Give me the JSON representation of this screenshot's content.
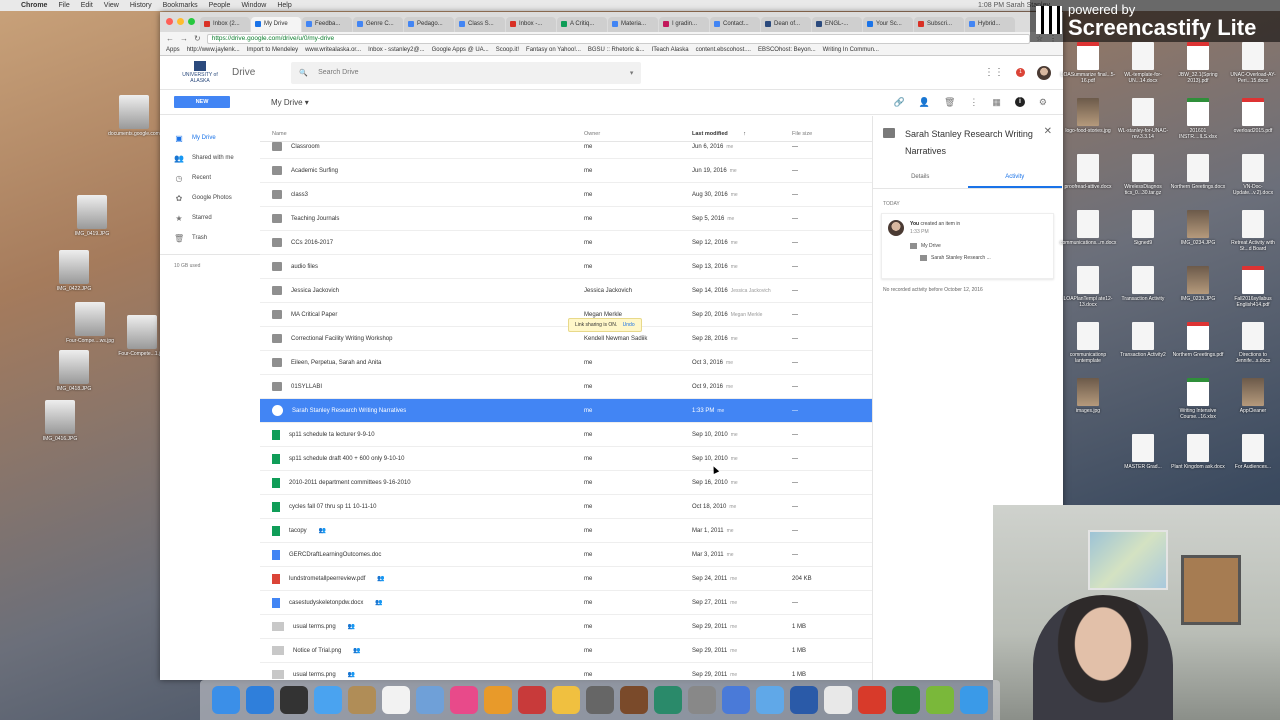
{
  "menubar": {
    "app": "Chrome",
    "items": [
      "File",
      "Edit",
      "View",
      "History",
      "Bookmarks",
      "People",
      "Window",
      "Help"
    ],
    "right_text": "1:08 PM   Sarah Stanley"
  },
  "browser": {
    "tabs": [
      {
        "label": "Inbox (2...",
        "color": "#d93025"
      },
      {
        "label": "My Drive",
        "color": "#1a73e8",
        "active": true
      },
      {
        "label": "Feedba...",
        "color": "#4285f4"
      },
      {
        "label": "Genre C...",
        "color": "#4285f4"
      },
      {
        "label": "Pedago...",
        "color": "#4285f4"
      },
      {
        "label": "Class S...",
        "color": "#4285f4"
      },
      {
        "label": "Inbox -...",
        "color": "#d93025"
      },
      {
        "label": "A Critiq...",
        "color": "#0f9d58"
      },
      {
        "label": "Materia...",
        "color": "#4285f4"
      },
      {
        "label": "I gradin...",
        "color": "#c2185b"
      },
      {
        "label": "Contact...",
        "color": "#4285f4"
      },
      {
        "label": "Dean of...",
        "color": "#2b4a7d"
      },
      {
        "label": "ENGL-...",
        "color": "#2b4a7d"
      },
      {
        "label": "Your Sc...",
        "color": "#1a73e8"
      },
      {
        "label": "Subscri...",
        "color": "#d93025"
      },
      {
        "label": "Hybrid...",
        "color": "#4285f4"
      }
    ],
    "url": "https://drive.google.com/drive/u/0/my-drive",
    "bookmarks": [
      "Apps",
      "http://www.jaylenk...",
      "Import to Mendeley",
      "www.writealaska.or...",
      "Inbox - sstanley2@...",
      "Google Apps @ UA...",
      "Scoop.it!",
      "Fantasy on Yahoo!...",
      "BGSU :: Rhetoric &...",
      "ITeach Alaska",
      "content.ebscohost....",
      "EBSCOhost: Beyon...",
      "Writing In Commun..."
    ]
  },
  "drive": {
    "logo_text": "UNIVERSITY of ALASKA",
    "product": "Drive",
    "search_placeholder": "Search Drive",
    "notif_count": "1",
    "new_button": "NEW",
    "location_label": "My Drive",
    "sidebar": [
      {
        "label": "My Drive",
        "icon": "drive-icon",
        "glyph": "▣",
        "active": true
      },
      {
        "label": "Shared with me",
        "icon": "people-icon",
        "glyph": "👥"
      },
      {
        "label": "Recent",
        "icon": "clock-icon",
        "glyph": "◷"
      },
      {
        "label": "Google Photos",
        "icon": "photos-icon",
        "glyph": "✿"
      },
      {
        "label": "Starred",
        "icon": "star-icon",
        "glyph": "★"
      },
      {
        "label": "Trash",
        "icon": "trash-icon",
        "glyph": "🗑"
      }
    ],
    "storage": "10 GB used",
    "columns": {
      "name": "Name",
      "owner": "Owner",
      "modified": "Last modified",
      "size": "File size"
    },
    "files": [
      {
        "name": "Classroom",
        "type": "shared-folder",
        "owner": "me",
        "modified": "Jun 6, 2016",
        "by": "me",
        "size": "—"
      },
      {
        "name": "Academic Surfing",
        "type": "folder",
        "owner": "me",
        "modified": "Jun 19, 2016",
        "by": "me",
        "size": "—"
      },
      {
        "name": "class3",
        "type": "folder",
        "owner": "me",
        "modified": "Aug 30, 2016",
        "by": "me",
        "size": "—"
      },
      {
        "name": "Teaching Journals",
        "type": "folder",
        "owner": "me",
        "modified": "Sep 5, 2016",
        "by": "me",
        "size": "—"
      },
      {
        "name": "CCs 2016-2017",
        "type": "shared-folder",
        "owner": "me",
        "modified": "Sep 12, 2016",
        "by": "me",
        "size": "—"
      },
      {
        "name": "audio files",
        "type": "shared-folder",
        "owner": "me",
        "modified": "Sep 13, 2016",
        "by": "me",
        "size": "—"
      },
      {
        "name": "Jessica Jackovich",
        "type": "shared-folder",
        "owner": "Jessica Jackovich",
        "modified": "Sep 14, 2016",
        "by": "Jessica Jackovich",
        "size": "—"
      },
      {
        "name": "MA Critical Paper",
        "type": "shared-folder",
        "owner": "Megan Merkle",
        "modified": "Sep 20, 2016",
        "by": "Megan Merkle",
        "size": "—"
      },
      {
        "name": "Correctional Facility Writing Workshop",
        "type": "shared-folder",
        "owner": "Kendell Newman Sadiik",
        "modified": "Sep 28, 2016",
        "by": "me",
        "size": "—"
      },
      {
        "name": "Eileen, Perpetua, Sarah and Anita",
        "type": "shared-folder",
        "owner": "me",
        "modified": "Oct 3, 2016",
        "by": "me",
        "size": "—"
      },
      {
        "name": "01SYLLABI",
        "type": "folder",
        "owner": "me",
        "modified": "Oct 9, 2016",
        "by": "me",
        "size": "—"
      },
      {
        "name": "Sarah Stanley Research Writing Narratives",
        "type": "shared-folder",
        "owner": "me",
        "modified": "1:33 PM",
        "by": "me",
        "size": "—",
        "selected": true
      },
      {
        "name": "sp11 schedule ta lecturer 9-9-10",
        "type": "sheet",
        "owner": "me",
        "modified": "Sep 10, 2010",
        "by": "me",
        "size": "—"
      },
      {
        "name": "sp11 schedule draft 400 + 600 only 9-10-10",
        "type": "sheet",
        "owner": "me",
        "modified": "Sep 10, 2010",
        "by": "me",
        "size": "—"
      },
      {
        "name": "2010-2011 department committees 9-16-2010",
        "type": "sheet",
        "owner": "me",
        "modified": "Sep 16, 2010",
        "by": "me",
        "size": "—"
      },
      {
        "name": "cycles fall 07 thru sp 11 10-11-10",
        "type": "sheet",
        "owner": "me",
        "modified": "Oct 18, 2010",
        "by": "me",
        "size": "—"
      },
      {
        "name": "tacopy",
        "type": "sheet",
        "owner": "me",
        "modified": "Mar 1, 2011",
        "by": "me",
        "size": "—",
        "shared": true
      },
      {
        "name": "GERCDraftLearningOutcomes.doc",
        "type": "doc",
        "owner": "me",
        "modified": "Mar 3, 2011",
        "by": "me",
        "size": "—"
      },
      {
        "name": "lundstrometallpeerreview.pdf",
        "type": "pdf",
        "owner": "me",
        "modified": "Sep 24, 2011",
        "by": "me",
        "size": "204 KB",
        "shared": true
      },
      {
        "name": "casestudyskeletonpdw.docx",
        "type": "doc",
        "owner": "me",
        "modified": "Sep 27, 2011",
        "by": "me",
        "size": "—",
        "shared": true
      },
      {
        "name": "usual terms.png",
        "type": "image",
        "owner": "me",
        "modified": "Sep 29, 2011",
        "by": "me",
        "size": "1 MB",
        "shared": true
      },
      {
        "name": "Notice of Trial.png",
        "type": "image",
        "owner": "me",
        "modified": "Sep 29, 2011",
        "by": "me",
        "size": "1 MB",
        "shared": true
      },
      {
        "name": "usual terms.png",
        "type": "image",
        "owner": "me",
        "modified": "Sep 29, 2011",
        "by": "me",
        "size": "1 MB",
        "shared": true
      }
    ],
    "toast": {
      "text": "Link sharing is ON.",
      "action": "Undo"
    },
    "details": {
      "title": "Sarah Stanley Research Writing Narratives",
      "tab_details": "Details",
      "tab_activity": "Activity",
      "today": "TODAY",
      "actor": "You",
      "action": "created an item in",
      "time": "1:33 PM",
      "parent": "My Drive",
      "item": "Sarah Stanley Research ...",
      "no_activity": "No recorded activity before October 12, 2016"
    }
  },
  "desktop": {
    "left_icons": [
      "documents.google.com",
      "IMG_0419.JPG",
      "IMG_0422.JPG",
      "Four-Compe....ws.jpg",
      "Four-Compete...1.jpg",
      "IMG_0418.JPG",
      "IMG_0416.JPG"
    ],
    "right_icons": [
      "LOASummarize final...5-16.pdf",
      "WL-template-for-UN...14.docx",
      "JBW_32.1(Spring 2013).pdf",
      "UNAC-Overload-AY-Peri...15.docx",
      "logo-food-stories.jpg",
      "WL-stanley-for-UNAC-rev.3.3.14",
      "201601 INSTR....ILS.xlsx",
      "overload2015.pdf",
      "proofread-attive.docx",
      "WirelessDiagnos tics_0...30.tar.gz",
      "Northern Greetings.docx",
      "VN-Doc-Update...v.2).docx",
      "communications...m.docx",
      "Signed9",
      "IMG_0234.JPG",
      "Retreat Activity with St...d Board",
      "LOAPlanTempl ate12-13.docx",
      "Transaction Activity",
      "IMG_0233.JPG",
      "Fall2016syllabus English414.pdf",
      "communicationp lantemplate",
      "Transaction Activity2",
      "Northern Greetings.pdf",
      "Directions to Jennife...s.docx",
      "images.jpg",
      "Writing Intensive Course...16.xlsx",
      "AppCleaner",
      "Plant Kingdom ask.docx",
      "MASTER Grad...",
      "For Audiences..."
    ]
  },
  "screencastify": {
    "powered": "powered by",
    "brand": "Screencastify Lite"
  },
  "dock": {
    "colors": [
      "#3b8fe8",
      "#2f7fdb",
      "#333",
      "#4aa3f0",
      "#b08d57",
      "#f2f2f2",
      "#6fa0d8",
      "#e84a8a",
      "#e89a2a",
      "#c83a3a",
      "#f0c040",
      "#666",
      "#7a4a2a",
      "#2a8a6a",
      "#888",
      "#4a7ad8",
      "#60a8e8",
      "#2a5aa8",
      "#e8e8e8",
      "#d83a2a",
      "#2a8a3a",
      "#7ab83a",
      "#3a9ae8"
    ]
  }
}
